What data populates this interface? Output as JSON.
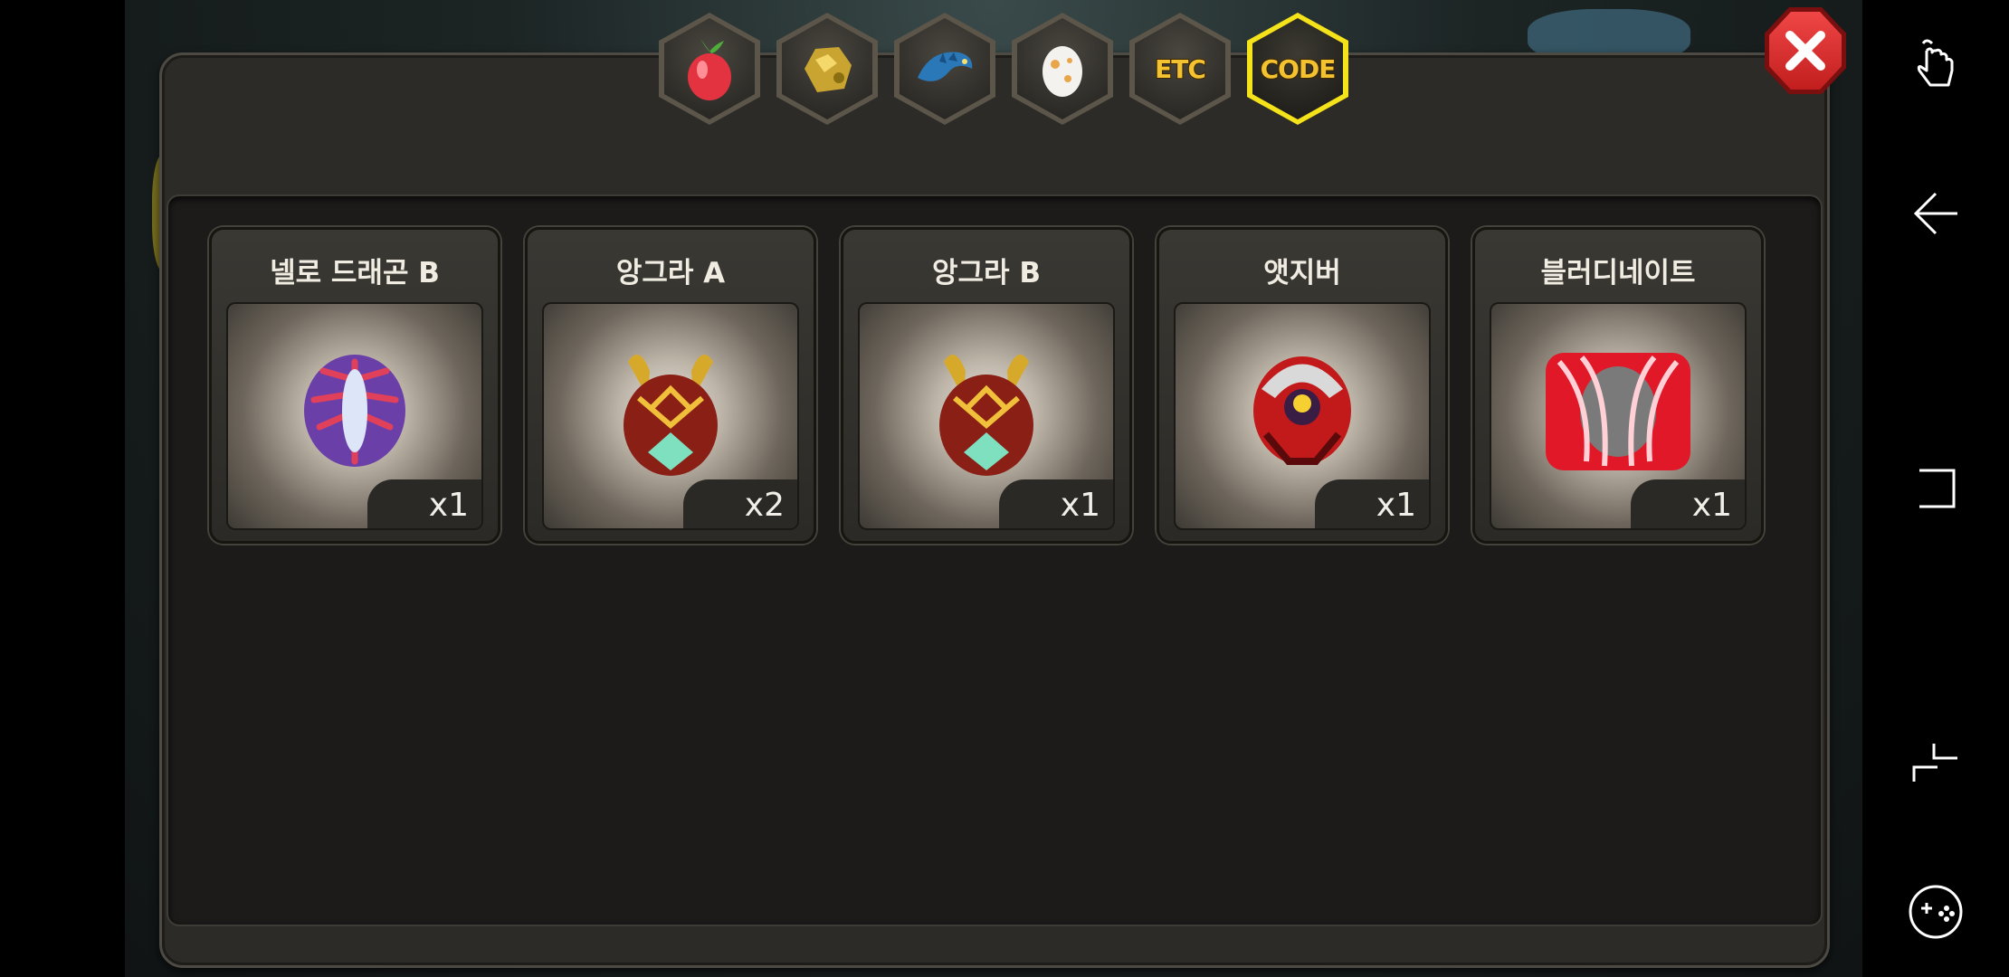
{
  "tabs": [
    {
      "name": "fruit",
      "icon": "fruit-icon",
      "label": ""
    },
    {
      "name": "gold",
      "icon": "gold-nugget-icon",
      "label": ""
    },
    {
      "name": "dragon",
      "icon": "dragon-icon",
      "label": ""
    },
    {
      "name": "egg",
      "icon": "egg-icon",
      "label": ""
    },
    {
      "name": "etc",
      "icon": "",
      "label": "ETC"
    },
    {
      "name": "code",
      "icon": "",
      "label": "CODE",
      "active": true
    }
  ],
  "items": [
    {
      "name": "넬로 드래곤 B",
      "qty": "x1",
      "icon": "purple-egg-icon",
      "color": "#6b3fa8"
    },
    {
      "name": "앙그라 A",
      "qty": "x2",
      "icon": "angra-egg-icon",
      "color": "#8a1f16"
    },
    {
      "name": "앙그라 B",
      "qty": "x1",
      "icon": "angra-egg-icon",
      "color": "#8a1f16"
    },
    {
      "name": "앳지버",
      "qty": "x1",
      "icon": "red-mech-egg-icon",
      "color": "#c21a1a"
    },
    {
      "name": "블러디네이트",
      "qty": "x1",
      "icon": "bloody-egg-icon",
      "color": "#e01828"
    }
  ],
  "colors": {
    "active_tab": "#f4e21a",
    "close_button": "#e03030",
    "panel": "#2c2b27"
  }
}
